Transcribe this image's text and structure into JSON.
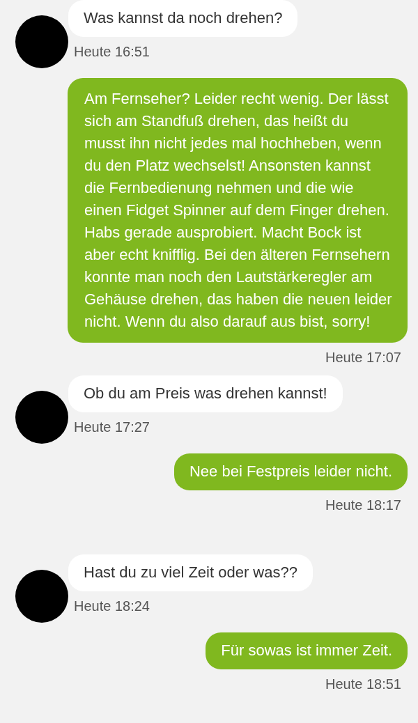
{
  "messages": [
    {
      "kind": "incoming",
      "text": "Was kannst da noch drehen?",
      "time": "Heute 16:51"
    },
    {
      "kind": "outgoing",
      "text": "Am Fernseher? Leider recht wenig. Der lässt sich am Standfuß drehen, das heißt du musst ihn nicht jedes mal hochheben, wenn du den Platz wechselst! Ansonsten kannst die Fernbedienung nehmen und die wie einen Fidget Spinner auf dem Finger drehen. Habs gerade ausprobiert. Macht Bock ist aber echt knifflig. Bei den älteren Fernsehern konnte man noch den Lautstärkeregler am Gehäuse drehen, das haben die neuen leider nicht. Wenn du also darauf aus bist, sorry!",
      "time": "Heute 17:07"
    },
    {
      "kind": "incoming",
      "text": "Ob du am Preis was drehen kannst!",
      "time": "Heute 17:27"
    },
    {
      "kind": "outgoing",
      "text": "Nee bei Festpreis leider nicht.",
      "time": "Heute 18:17"
    },
    {
      "kind": "incoming",
      "text": "Hast du zu viel Zeit oder was??",
      "time": "Heute 18:24"
    },
    {
      "kind": "outgoing",
      "text": "Für sowas ist immer Zeit.",
      "time": "Heute 18:51"
    }
  ]
}
